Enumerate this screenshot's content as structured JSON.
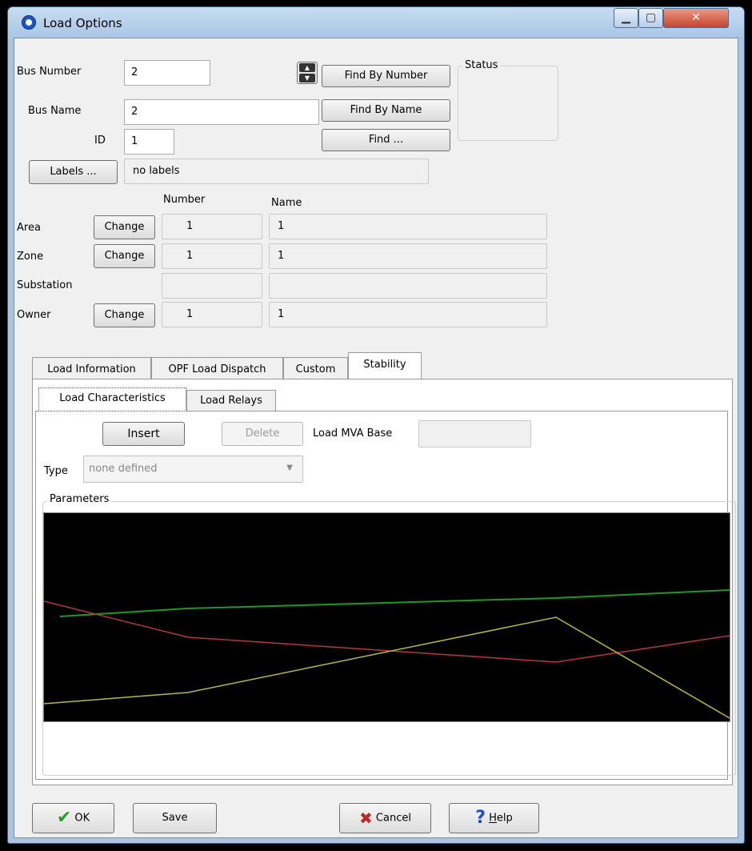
{
  "window": {
    "title": "Load Options"
  },
  "bus": {
    "number_label": "Bus Number",
    "number_value": "2",
    "name_label": "Bus Name",
    "name_value": "2",
    "id_label": "ID",
    "id_value": "1",
    "find_by_number": "Find By Number",
    "find_by_name": "Find By Name",
    "find": "Find ...",
    "status_label": "Status",
    "labels_button": "Labels ...",
    "labels_value": "no labels"
  },
  "table": {
    "number_header": "Number",
    "name_header": "Name",
    "change_label": "Change",
    "rows": [
      {
        "label": "Area",
        "number": "1",
        "name": "1",
        "has_change": true
      },
      {
        "label": "Zone",
        "number": "1",
        "name": "1",
        "has_change": true
      },
      {
        "label": "Substation",
        "number": "",
        "name": "",
        "has_change": false
      },
      {
        "label": "Owner",
        "number": "1",
        "name": "1",
        "has_change": true
      }
    ]
  },
  "tabs": [
    "Load Information",
    "OPF Load Dispatch",
    "Custom",
    "Stability"
  ],
  "active_tab": "Stability",
  "subtabs": [
    "Load Characteristics",
    "Load Relays"
  ],
  "active_subtab": "Load Characteristics",
  "stability": {
    "insert": "Insert",
    "delete": "Delete",
    "mva_label": "Load MVA Base",
    "mva_value": "",
    "type_label": "Type",
    "type_value": "none defined",
    "parameters_label": "Parameters"
  },
  "footer": {
    "ok": "OK",
    "save": "Save",
    "cancel": "Cancel",
    "help_prefix": "",
    "help_hotkey": "H",
    "help_rest": "elp"
  },
  "colors": {
    "line_green": "#1f9a1f",
    "line_red": "#b23a3a",
    "line_yellow": "#b8b84a",
    "close_red": "#c6442a"
  }
}
